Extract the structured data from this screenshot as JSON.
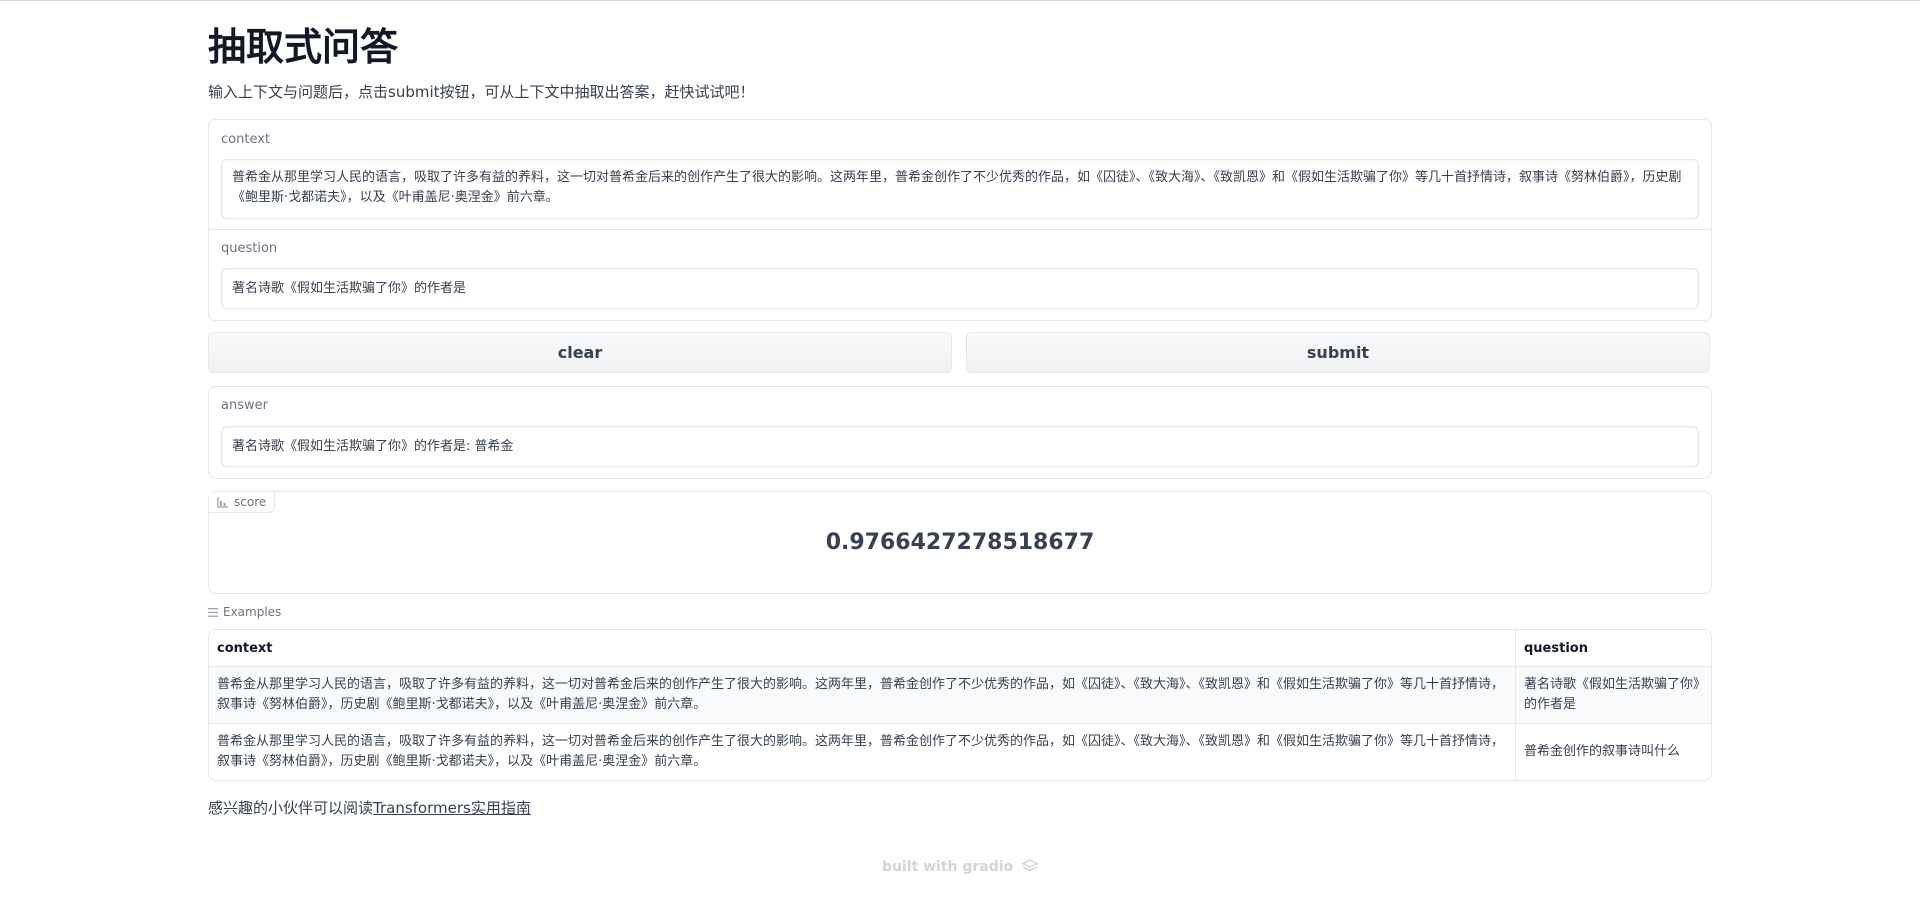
{
  "page": {
    "title": "抽取式问答",
    "description": "输入上下文与问题后，点击submit按钮，可从上下文中抽取出答案，赶快试试吧！"
  },
  "inputs": {
    "context_label": "context",
    "context_value": "普希金从那里学习人民的语言，吸取了许多有益的养料，这一切对普希金后来的创作产生了很大的影响。这两年里，普希金创作了不少优秀的作品，如《囚徒》、《致大海》、《致凯恩》和《假如生活欺骗了你》等几十首抒情诗，叙事诗《努林伯爵》，历史剧《鲍里斯·戈都诺夫》，以及《叶甫盖尼·奥涅金》前六章。",
    "question_label": "question",
    "question_value": "著名诗歌《假如生活欺骗了你》的作者是"
  },
  "buttons": {
    "clear_label": "clear",
    "submit_label": "submit"
  },
  "outputs": {
    "answer_label": "answer",
    "answer_value": "著名诗歌《假如生活欺骗了你》的作者是: 普希金",
    "score_label": "score",
    "score_value": "0.9766427278518677"
  },
  "examples": {
    "label": "Examples",
    "headers": [
      "context",
      "question"
    ],
    "rows": [
      {
        "context": "普希金从那里学习人民的语言，吸取了许多有益的养料，这一切对普希金后来的创作产生了很大的影响。这两年里，普希金创作了不少优秀的作品，如《囚徒》、《致大海》、《致凯恩》和《假如生活欺骗了你》等几十首抒情诗，叙事诗《努林伯爵》，历史剧《鲍里斯·戈都诺夫》，以及《叶甫盖尼·奥涅金》前六章。",
        "question": "著名诗歌《假如生活欺骗了你》的作者是"
      },
      {
        "context": "普希金从那里学习人民的语言，吸取了许多有益的养料，这一切对普希金后来的创作产生了很大的影响。这两年里，普希金创作了不少优秀的作品，如《囚徒》、《致大海》、《致凯恩》和《假如生活欺骗了你》等几十首抒情诗，叙事诗《努林伯爵》，历史剧《鲍里斯·戈都诺夫》，以及《叶甫盖尼·奥涅金》前六章。",
        "question": "普希金创作的叙事诗叫什么"
      }
    ]
  },
  "footer": {
    "note_prefix": "感兴趣的小伙伴可以阅读",
    "note_link": "Transformers实用指南",
    "built_with": "built with gradio"
  },
  "icons": {
    "score_icon": "bar-chart-icon",
    "examples_icon": "list-icon",
    "gradio_icon": "gradio-logo-icon"
  }
}
